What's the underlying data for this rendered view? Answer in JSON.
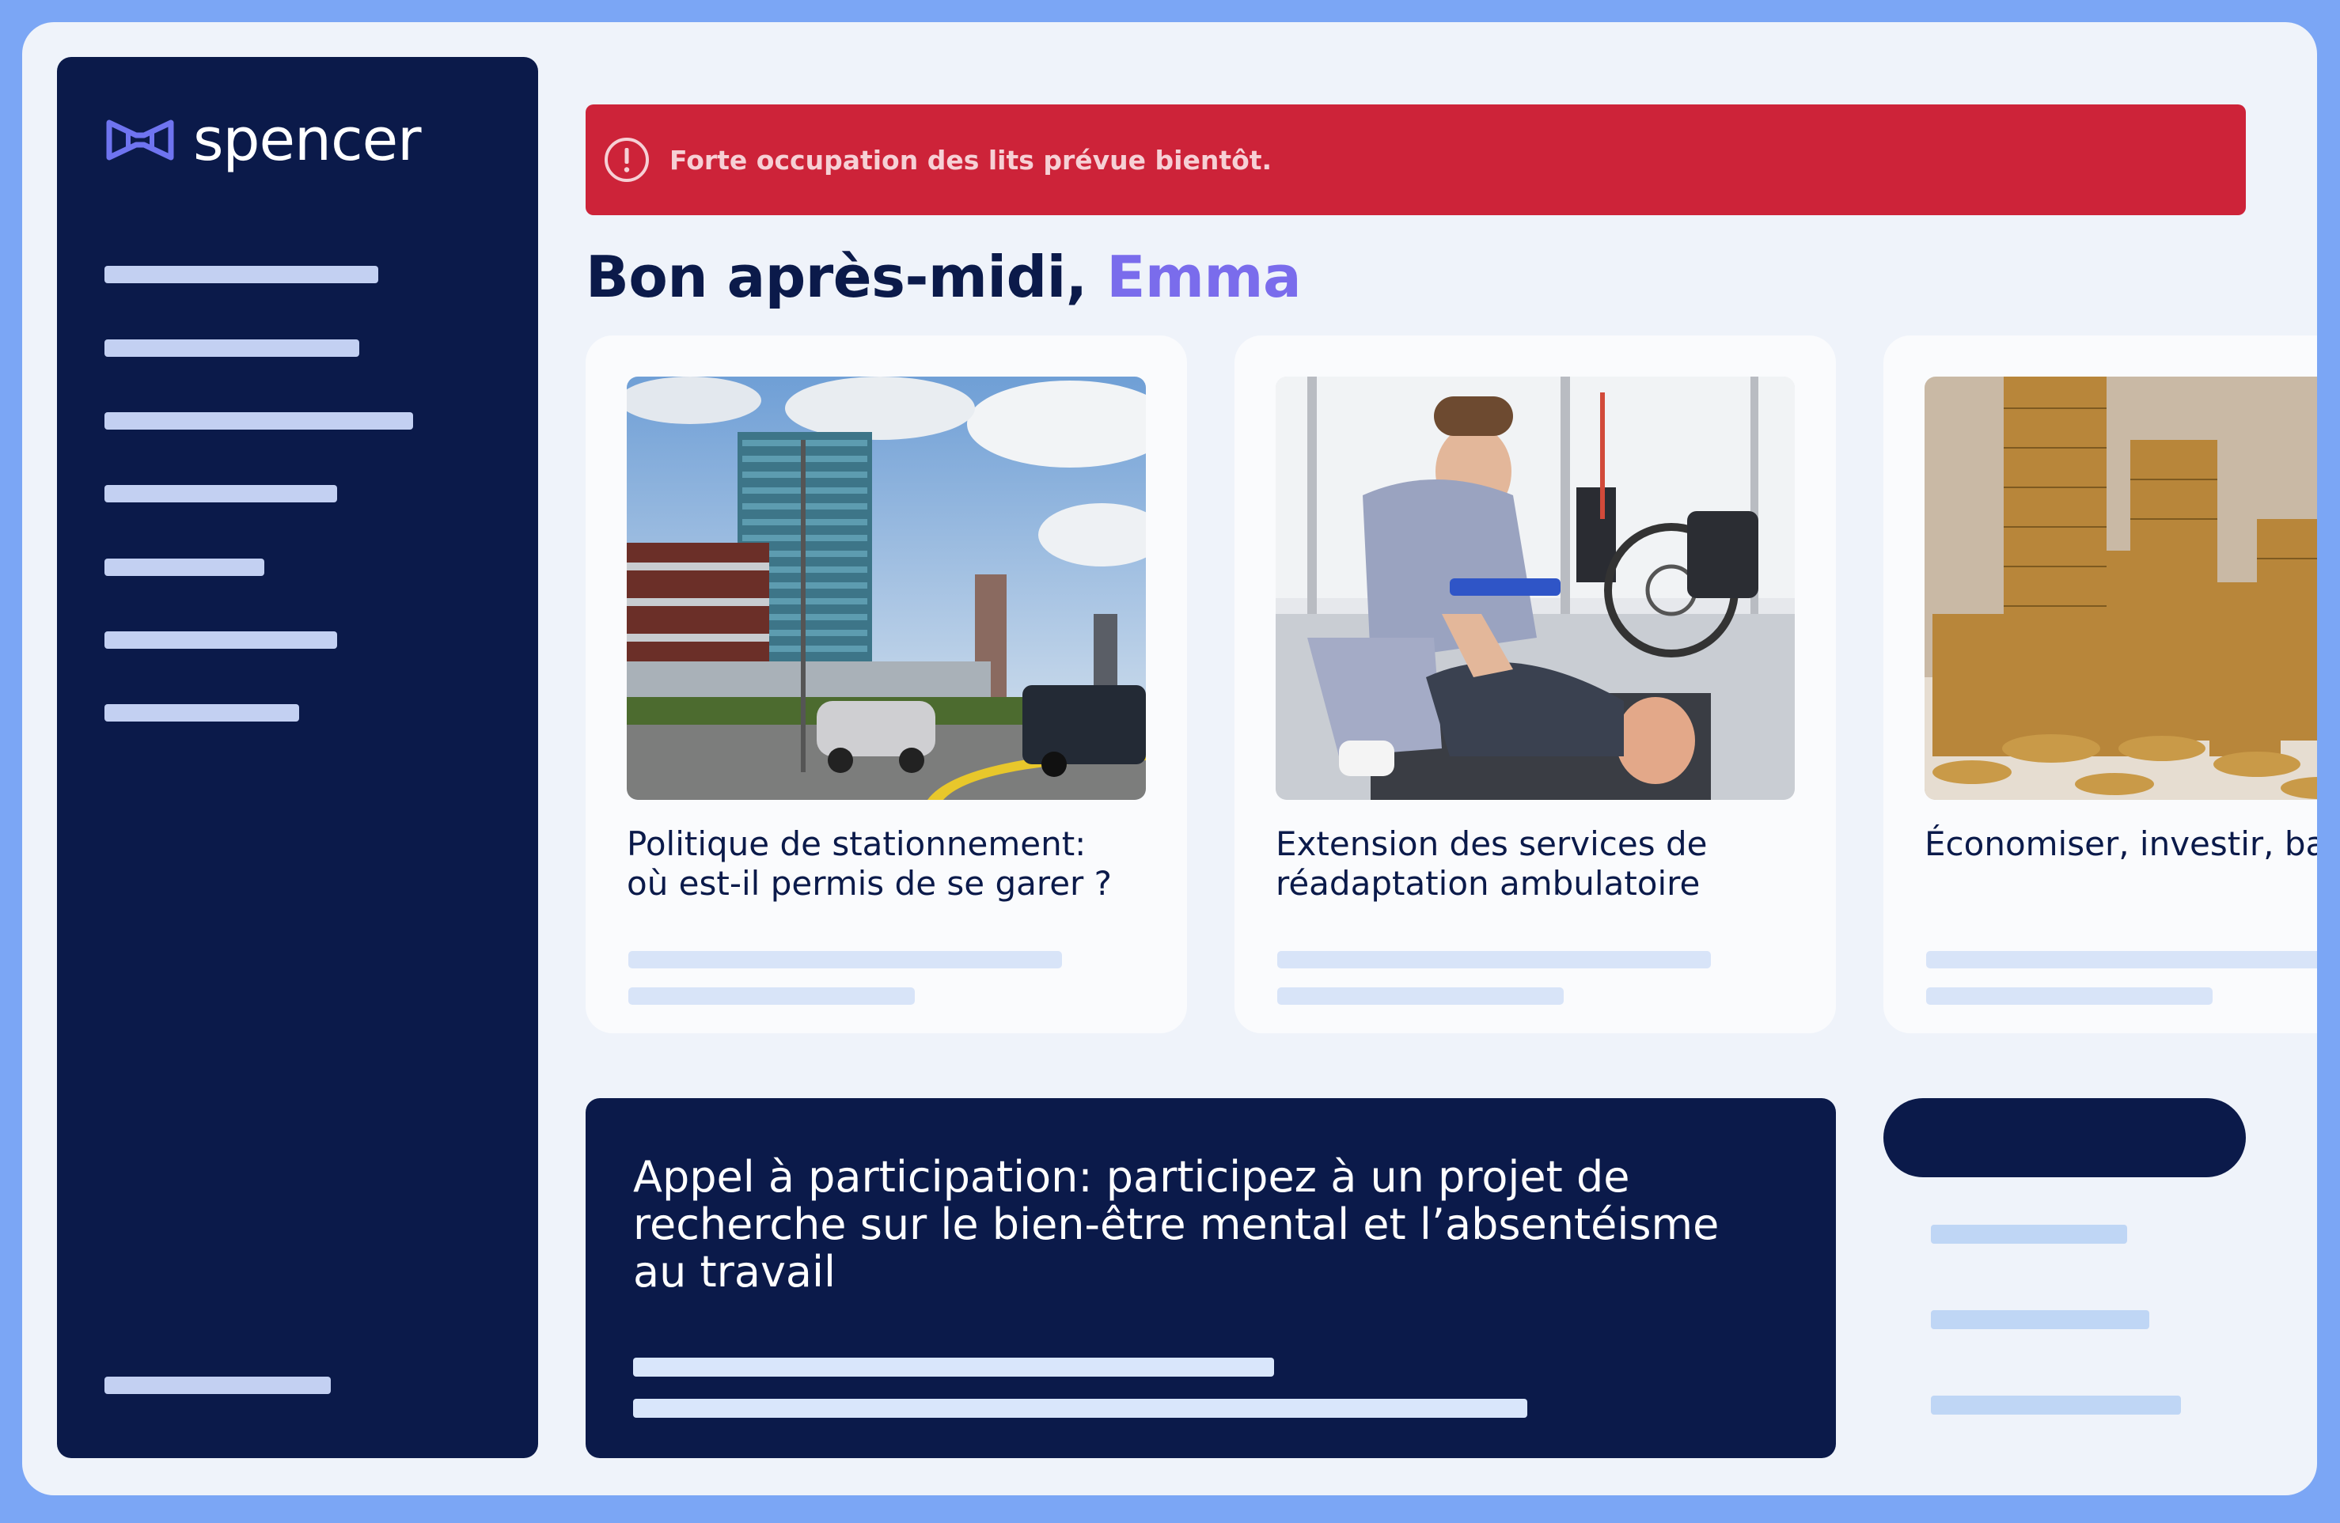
{
  "app": {
    "name": "spencer",
    "logo_icon": "bowtie-logo-icon"
  },
  "alert": {
    "icon": "exclamation-circle-icon",
    "message": "Forte occupation des lits prévue bientôt.",
    "color": "#cd2339"
  },
  "greeting": {
    "prefix": "Bon après-midi, ",
    "name": "Emma"
  },
  "cards": [
    {
      "title_line1": "Politique de stationnement:",
      "title_line2": "où est-il permis de se garer ?"
    },
    {
      "title_line1": "Extension des services de",
      "title_line2": "réadaptation ambulatoire"
    },
    {
      "title_line1": "Économiser, investir, ba",
      "title_line2": ""
    }
  ],
  "promo": {
    "title": "Appel à participation: participez à un projet de recherche sur le bien-être mental et l’absentéisme au travail"
  },
  "colors": {
    "navy": "#0b1a4a",
    "accent_purple": "#7a6cec",
    "frame_blue": "#7ba6f5",
    "background": "#eff3fa"
  }
}
